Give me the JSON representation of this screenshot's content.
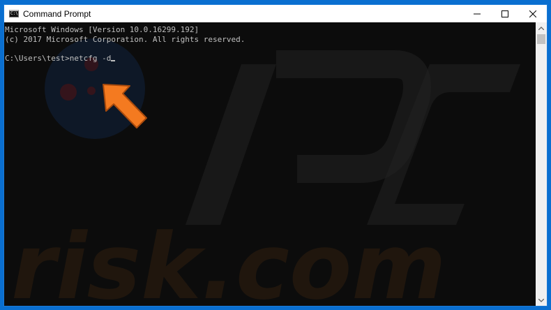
{
  "window": {
    "title": "Command Prompt"
  },
  "console": {
    "lines": [
      "Microsoft Windows [Version 10.0.16299.192]",
      "(c) 2017 Microsoft Corporation. All rights reserved.",
      "",
      "C:\\Users\\test>netcfg -d"
    ]
  },
  "watermark": {
    "text": "risk.com"
  },
  "colors": {
    "accent_border": "#1a7ad6",
    "console_bg": "#0c0c0c",
    "console_text": "#c0c0c0",
    "arrow": "#f47a20"
  },
  "icons": {
    "app": "cmd-icon",
    "minimize": "minimize-icon",
    "maximize": "maximize-icon",
    "close": "close-icon"
  }
}
